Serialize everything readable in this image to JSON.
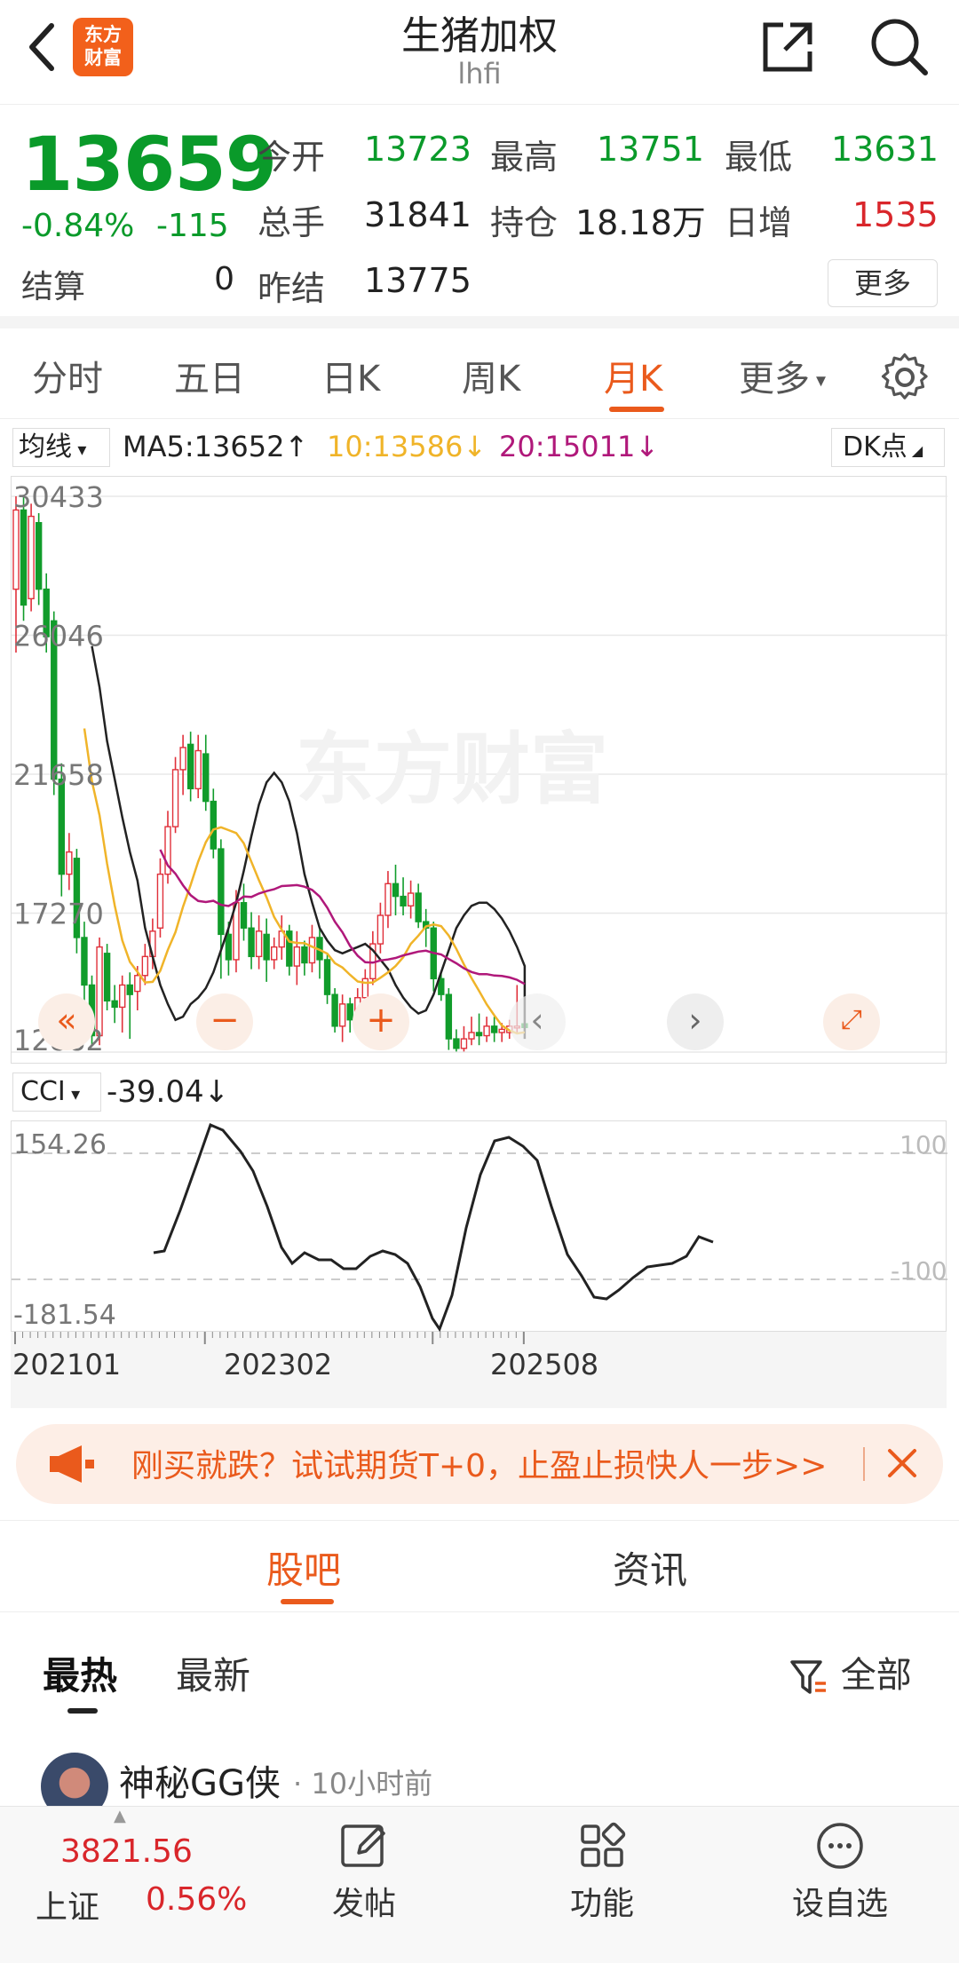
{
  "header": {
    "logo_text_line1": "东方",
    "logo_text_line2": "财富",
    "title": "生猪加权",
    "subtitle": "lhfi"
  },
  "quote": {
    "price": "13659",
    "change_pct": "-0.84%",
    "change_abs": "-115",
    "settle_label": "结算",
    "settle_value": "0",
    "open_label": "今开",
    "open_value": "13723",
    "high_label": "最高",
    "high_value": "13751",
    "low_label": "最低",
    "low_value": "13631",
    "volume_label": "总手",
    "volume_value": "31841",
    "oi_label": "持仓",
    "oi_value": "18.18万",
    "daily_inc_label": "日增",
    "daily_inc_value": "1535",
    "prev_settle_label": "昨结",
    "prev_settle_value": "13775",
    "more_label": "更多"
  },
  "period_tabs": {
    "items": [
      "分时",
      "五日",
      "日K",
      "周K",
      "月K",
      "更多"
    ],
    "active": "月K"
  },
  "ma_legend": {
    "selector": "均线",
    "ma5": "MA5:13652↑",
    "ma10": "10:13586↓",
    "ma20": "20:15011↓",
    "dk_label": "DK点",
    "ma5_color": "#222222",
    "ma10_color": "#f0b429",
    "ma20_color": "#b0187a"
  },
  "chart_data": [
    {
      "type": "candlestick",
      "yticks": [
        "30433",
        "26046",
        "21658",
        "17270",
        "12882"
      ],
      "ylim": [
        12882,
        30433
      ],
      "watermark": "东方财富",
      "candles": [
        {
          "o": 27500,
          "c": 30000,
          "h": 30433,
          "l": 25500
        },
        {
          "o": 30000,
          "c": 27000,
          "h": 30400,
          "l": 26500
        },
        {
          "o": 27200,
          "c": 29800,
          "h": 30200,
          "l": 26800
        },
        {
          "o": 29600,
          "c": 27500,
          "h": 29900,
          "l": 27000
        },
        {
          "o": 27500,
          "c": 26000,
          "h": 28000,
          "l": 25500
        },
        {
          "o": 26500,
          "c": 21500,
          "h": 26800,
          "l": 21000
        },
        {
          "o": 21500,
          "c": 18500,
          "h": 22000,
          "l": 17800
        },
        {
          "o": 18500,
          "c": 19200,
          "h": 19800,
          "l": 18000
        },
        {
          "o": 19000,
          "c": 16500,
          "h": 19300,
          "l": 16000
        },
        {
          "o": 16500,
          "c": 15000,
          "h": 17000,
          "l": 14200
        },
        {
          "o": 15000,
          "c": 13400,
          "h": 15300,
          "l": 13100
        },
        {
          "o": 13400,
          "c": 16200,
          "h": 16500,
          "l": 13100
        },
        {
          "o": 16000,
          "c": 14500,
          "h": 16300,
          "l": 14200
        },
        {
          "o": 14500,
          "c": 14300,
          "h": 15000,
          "l": 13800
        },
        {
          "o": 14300,
          "c": 15000,
          "h": 15300,
          "l": 13500
        },
        {
          "o": 15000,
          "c": 14700,
          "h": 15400,
          "l": 13300
        },
        {
          "o": 14800,
          "c": 15300,
          "h": 15600,
          "l": 14200
        },
        {
          "o": 15300,
          "c": 15900,
          "h": 16300,
          "l": 15000
        },
        {
          "o": 15900,
          "c": 16700,
          "h": 17100,
          "l": 15500
        },
        {
          "o": 16800,
          "c": 18500,
          "h": 19000,
          "l": 16500
        },
        {
          "o": 18500,
          "c": 20000,
          "h": 20500,
          "l": 18200
        },
        {
          "o": 20000,
          "c": 21800,
          "h": 22200,
          "l": 19800
        },
        {
          "o": 21800,
          "c": 22500,
          "h": 22900,
          "l": 21000
        },
        {
          "o": 22600,
          "c": 21200,
          "h": 23000,
          "l": 20800
        },
        {
          "o": 21200,
          "c": 22400,
          "h": 22900,
          "l": 20900
        },
        {
          "o": 22300,
          "c": 20800,
          "h": 22900,
          "l": 20500
        },
        {
          "o": 20800,
          "c": 19300,
          "h": 21200,
          "l": 19000
        },
        {
          "o": 19300,
          "c": 16600,
          "h": 19600,
          "l": 15200
        },
        {
          "o": 16600,
          "c": 15800,
          "h": 17000,
          "l": 15300
        },
        {
          "o": 15800,
          "c": 17600,
          "h": 18000,
          "l": 15400
        },
        {
          "o": 17600,
          "c": 16800,
          "h": 18200,
          "l": 16400
        },
        {
          "o": 16800,
          "c": 15900,
          "h": 17300,
          "l": 15500
        },
        {
          "o": 15900,
          "c": 16700,
          "h": 17200,
          "l": 15500
        },
        {
          "o": 16600,
          "c": 15800,
          "h": 17100,
          "l": 15100
        },
        {
          "o": 15800,
          "c": 16200,
          "h": 16500,
          "l": 15500
        },
        {
          "o": 16200,
          "c": 16700,
          "h": 17200,
          "l": 15800
        },
        {
          "o": 16700,
          "c": 15600,
          "h": 16900,
          "l": 15300
        },
        {
          "o": 15600,
          "c": 16200,
          "h": 16700,
          "l": 15000
        },
        {
          "o": 16200,
          "c": 15700,
          "h": 16400,
          "l": 15300
        },
        {
          "o": 15700,
          "c": 16500,
          "h": 16900,
          "l": 15400
        },
        {
          "o": 16500,
          "c": 15800,
          "h": 16800,
          "l": 15200
        },
        {
          "o": 15800,
          "c": 14700,
          "h": 16000,
          "l": 14400
        },
        {
          "o": 14700,
          "c": 13700,
          "h": 14900,
          "l": 13500
        },
        {
          "o": 13700,
          "c": 14400,
          "h": 14700,
          "l": 13200
        },
        {
          "o": 14400,
          "c": 13900,
          "h": 14600,
          "l": 13500
        },
        {
          "o": 13900,
          "c": 14600,
          "h": 14900,
          "l": 13700
        },
        {
          "o": 14600,
          "c": 15200,
          "h": 15500,
          "l": 14300
        },
        {
          "o": 15200,
          "c": 16300,
          "h": 16700,
          "l": 15000
        },
        {
          "o": 16300,
          "c": 17200,
          "h": 17600,
          "l": 16000
        },
        {
          "o": 17200,
          "c": 18200,
          "h": 18600,
          "l": 16800
        },
        {
          "o": 18200,
          "c": 17800,
          "h": 18800,
          "l": 17200
        },
        {
          "o": 17800,
          "c": 17500,
          "h": 18400,
          "l": 17200
        },
        {
          "o": 17500,
          "c": 17900,
          "h": 18300,
          "l": 17100
        },
        {
          "o": 17900,
          "c": 17000,
          "h": 18200,
          "l": 16800
        },
        {
          "o": 17000,
          "c": 16800,
          "h": 17400,
          "l": 16200
        },
        {
          "o": 16800,
          "c": 15200,
          "h": 17000,
          "l": 14800
        },
        {
          "o": 15200,
          "c": 14700,
          "h": 15400,
          "l": 14500
        },
        {
          "o": 14700,
          "c": 13300,
          "h": 14900,
          "l": 12950
        },
        {
          "o": 13300,
          "c": 13000,
          "h": 13600,
          "l": 12900
        },
        {
          "o": 13000,
          "c": 13300,
          "h": 13700,
          "l": 12900
        },
        {
          "o": 13300,
          "c": 13500,
          "h": 14000,
          "l": 13100
        },
        {
          "o": 13500,
          "c": 13400,
          "h": 14100,
          "l": 13100
        },
        {
          "o": 13400,
          "c": 13700,
          "h": 14000,
          "l": 13200
        },
        {
          "o": 13700,
          "c": 13500,
          "h": 14000,
          "l": 13200
        },
        {
          "o": 13500,
          "c": 13600,
          "h": 13800,
          "l": 13200
        },
        {
          "o": 13500,
          "c": 13700,
          "h": 13900,
          "l": 13300
        },
        {
          "o": 13700,
          "c": 13700,
          "h": 15000,
          "l": 13500
        },
        {
          "o": 13775,
          "c": 13659,
          "h": 13751,
          "l": 13631
        }
      ],
      "ma5": [
        null,
        null,
        null,
        null,
        null,
        null,
        null,
        null,
        null,
        null,
        25700,
        24400,
        22700,
        21500,
        20300,
        19200,
        18300,
        16800,
        15900,
        15000,
        14400,
        13900,
        14000,
        14400,
        14600,
        14900,
        15400,
        16100,
        16800,
        17600,
        18600,
        19700,
        20700,
        21400,
        21700,
        21400,
        20800,
        19800,
        18500,
        17600,
        16800,
        16400,
        16100,
        16000,
        16100,
        16200,
        16300,
        16100,
        15800,
        15500,
        15000,
        14600,
        14300,
        14100,
        14200,
        14700,
        15400,
        16100,
        16800,
        17200,
        17500,
        17600,
        17600,
        17400,
        17100,
        16700,
        16200,
        15600,
        14800,
        14200,
        13700,
        13400,
        13300,
        13400,
        13450,
        13500,
        13580,
        13652
      ]
    }
  ],
  "cci": {
    "selector": "CCI",
    "value": "-39.04↓",
    "yticks_left": [
      "154.26",
      "-181.54"
    ],
    "yticks_right": [
      "100",
      "-100"
    ],
    "dates": [
      "202101",
      "202302",
      "202508"
    ]
  },
  "promo": {
    "text": "刚买就跌？试试期货T+0，止盈止损快人一步>>"
  },
  "community": {
    "tabs": [
      "股吧",
      "资讯"
    ],
    "sub_tabs": [
      "最热",
      "最新"
    ],
    "filter_label": "全部",
    "post_author": "神秘GG侠",
    "post_time": "· 10小时前"
  },
  "bottom_bar": {
    "index_value": "3821.56",
    "index_name": "上证",
    "index_pct": "0.56%",
    "post_label": "发帖",
    "function_label": "功能",
    "watchlist_label": "设自选"
  }
}
